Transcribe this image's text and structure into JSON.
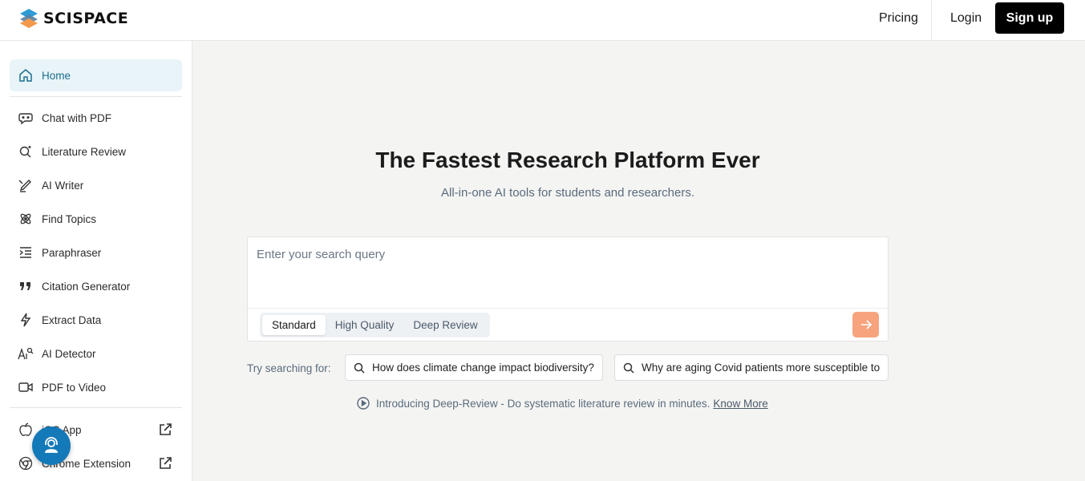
{
  "header": {
    "logo_text": "SCISPACE",
    "pricing_label": "Pricing",
    "login_label": "Login",
    "signup_label": "Sign up"
  },
  "sidebar": {
    "items": [
      {
        "label": "Home",
        "icon": "home-icon"
      },
      {
        "label": "Chat with PDF",
        "icon": "chat-icon"
      },
      {
        "label": "Literature Review",
        "icon": "search-sparkle-icon"
      },
      {
        "label": "AI Writer",
        "icon": "pen-icon"
      },
      {
        "label": "Find Topics",
        "icon": "atom-icon"
      },
      {
        "label": "Paraphraser",
        "icon": "indent-icon"
      },
      {
        "label": "Citation Generator",
        "icon": "quote-icon"
      },
      {
        "label": "Extract Data",
        "icon": "lightning-icon"
      },
      {
        "label": "AI Detector",
        "icon": "ai-detector-icon"
      },
      {
        "label": "PDF to Video",
        "icon": "video-icon"
      }
    ],
    "external": [
      {
        "label": "iOS App",
        "icon": "apple-icon"
      },
      {
        "label": "Chrome Extension",
        "icon": "chrome-icon"
      }
    ]
  },
  "main": {
    "title": "The Fastest Research Platform Ever",
    "subtitle": "All-in-one AI tools for students and researchers.",
    "search_placeholder": "Enter your search query",
    "modes": [
      "Standard",
      "High Quality",
      "Deep Review"
    ],
    "selected_mode": "Standard",
    "try_label": "Try searching for:",
    "suggestions": [
      "How does climate change impact biodiversity?",
      "Why are aging Covid patients more susceptible to"
    ],
    "intro_text": "Introducing Deep-Review - Do systematic literature review in minutes.",
    "intro_link": "Know More"
  },
  "colors": {
    "accent": "#1b6e8c",
    "submit": "#f6a37e",
    "support": "#1479b8"
  }
}
